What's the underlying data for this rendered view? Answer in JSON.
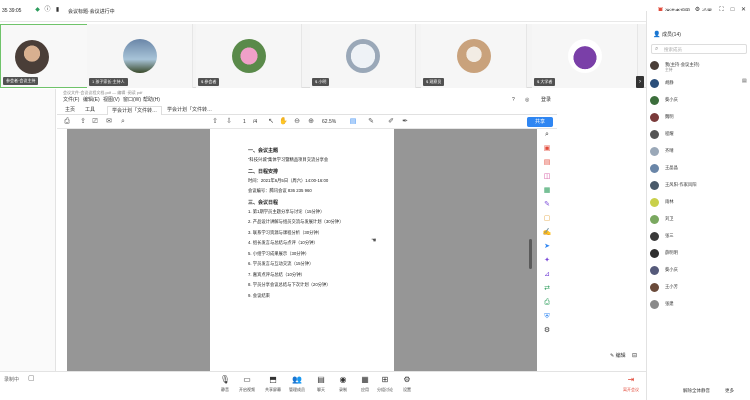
{
  "titlebar": {
    "time": "35  39:05",
    "meeting_title": "会议标题·会议进行中",
    "right_label": "演讲者视图",
    "settings_label": "设置",
    "icons": [
      "grid-icon",
      "fullscreen-icon",
      "minimize-icon",
      "maximize-icon",
      "close-icon"
    ]
  },
  "gallery": {
    "tiles": [
      {
        "name": "参会者·会议主持",
        "avatar_color": "#4a3e38"
      },
      {
        "name": "1 孩子家长·主持人",
        "avatar_color": "#6a86a8"
      },
      {
        "name": "$ 参会者",
        "avatar_color": "#d06a9a"
      },
      {
        "name": "$ 小明",
        "avatar_color": "#9aa8b8"
      },
      {
        "name": "$ 观察员",
        "avatar_color": "#c9a27c"
      },
      {
        "name": "$ 大学者",
        "avatar_color": "#7a3fa8"
      }
    ]
  },
  "pdf": {
    "window_title": "会议文件·会议议程文档.pdf — 编辑 ·阅读 pdf",
    "menu": [
      "文件(F)",
      "编辑(E)",
      "视图(V)",
      "窗口(W)",
      "帮助(H)"
    ],
    "menu_right": "登录",
    "tabs": [
      {
        "label": "主页"
      },
      {
        "label": "工具"
      },
      {
        "label": "学会计划「文件转…"
      },
      {
        "label": "学会计划「文件转…"
      }
    ],
    "page_indicator": "1",
    "page_total": "/4",
    "zoom": "62.5%",
    "share_label": "共享",
    "page_lines": [
      {
        "text": "一、会议主题",
        "h": true
      },
      {
        "text": "“科技兴城”集体学习暨精品项目交流分享会",
        "h": false
      },
      {
        "text": "二、日程安排",
        "h": true
      },
      {
        "text": "时间：2021年6月5日（周六）14:00-16:00",
        "h": false
      },
      {
        "text": "会议编号：腾讯会议 836 235 960",
        "h": false
      },
      {
        "text": "三、会议日程",
        "h": true
      },
      {
        "text": "1. 第1期学员主题分享与讨论（15分钟）",
        "h": false
      },
      {
        "text": "2. 产品设计讲解与组员交流与发展计划（30分钟）",
        "h": false
      },
      {
        "text": "3. 联系学习资源与课程分析（30分钟）",
        "h": false
      },
      {
        "text": "4. 组长发言与总结与点评（10分钟）",
        "h": false
      },
      {
        "text": "5. 小组学习成果展示（30分钟）",
        "h": false
      },
      {
        "text": "6. 学员发言与互动交流（15分钟）",
        "h": false
      },
      {
        "text": "7. 嘉宾点评与总结（10分钟）",
        "h": false
      },
      {
        "text": "8. 学员分享会议总结与下次计划（20分钟）",
        "h": false
      },
      {
        "text": "9. 会议结束",
        "h": false
      }
    ],
    "annotate_label": "编辑"
  },
  "participants": {
    "title": "成员(14)",
    "search_placeholder": "搜索成员",
    "list": [
      {
        "name": "我(主持·会议主持)",
        "sub": "主持",
        "color": "#4a3e38"
      },
      {
        "name": "胡静",
        "color": "#2b4f7a"
      },
      {
        "name": "葵小庆",
        "color": "#3c6e3c"
      },
      {
        "name": "魏明",
        "color": "#7a3a3a"
      },
      {
        "name": "程耀",
        "color": "#555555"
      },
      {
        "name": "齐晴",
        "color": "#9aa8b8"
      },
      {
        "name": "王晶晶",
        "color": "#6a86a8"
      },
      {
        "name": "王风阳·作家风阳",
        "color": "#4a5a6a"
      },
      {
        "name": "雨林",
        "color": "#c9d04a"
      },
      {
        "name": "刘卫",
        "color": "#7aa860"
      },
      {
        "name": "张三",
        "color": "#3a3a3a"
      },
      {
        "name": "薛明明",
        "color": "#2f2f2f"
      },
      {
        "name": "葵小庆",
        "color": "#555a7a"
      },
      {
        "name": "王小芳",
        "color": "#6a4a3a"
      },
      {
        "name": "张建",
        "color": "#8a8a8a"
      }
    ],
    "mute_all": "全体静音",
    "invite_label": "邀请",
    "footer_left": "解除全体静音",
    "footer_right": "更多"
  },
  "bottombar": {
    "left_label": "录制中",
    "items": [
      {
        "label": "静音",
        "icon": "mic-icon"
      },
      {
        "label": "开启视频",
        "icon": "camera-icon"
      },
      {
        "label": "共享屏幕",
        "icon": "screen-share-icon"
      },
      {
        "label": "管理成员",
        "icon": "members-icon"
      },
      {
        "label": "聊天",
        "icon": "chat-icon"
      },
      {
        "label": "录制",
        "icon": "record-icon"
      },
      {
        "label": "应用",
        "icon": "apps-icon"
      },
      {
        "label": "分组讨论",
        "icon": "breakout-icon"
      },
      {
        "label": "设置",
        "icon": "settings-icon"
      }
    ],
    "leave_label": "离开会议"
  }
}
